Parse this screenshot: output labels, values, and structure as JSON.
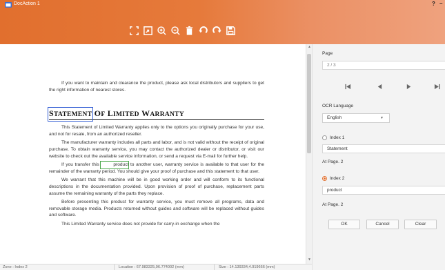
{
  "window": {
    "title": "DocAction 1",
    "help": "?",
    "minimize": "–"
  },
  "toolbar": {
    "buttons": [
      {
        "name": "fit-page-icon"
      },
      {
        "name": "fit-width-icon"
      },
      {
        "name": "zoom-in-icon"
      },
      {
        "name": "zoom-out-icon"
      },
      {
        "name": "delete-icon"
      },
      {
        "name": "rotate-left-icon"
      },
      {
        "name": "rotate-right-icon"
      },
      {
        "name": "save-icon"
      }
    ]
  },
  "document": {
    "intro": "If you want to maintain and clearance the product, please ask local distributors and suppliers to get the right information of nearest stores.",
    "heading_word1_cap": "S",
    "heading_word1_rest": "TATEMENT",
    "heading_rest": " OF LIMITED WARRANTY",
    "heading_of_cap": "O",
    "heading_of_rest": "F",
    "heading_l_cap": "L",
    "heading_l_rest": "IMITED",
    "heading_w_cap": "W",
    "heading_w_rest": "ARRANTY",
    "p1": "This Statement of Limited Warranty applies only to the options you originally purchase for your use, and not for resale, from an authorized reseller.",
    "p2": "The manufacturer warranty includes all parts and labor, and is not valid without the receipt of original purchase. To obtain warranty service, you may contact the authorized dealer or distributor, or visit our website to check out the available service information, or send a request via E-mail for further help.",
    "p3_before": "If you transfer this ",
    "p3_highlight": "product",
    "p3_after": " to another user, warranty service is available to that user for the remainder of the warranty period. You should give your proof of purchase and this statement to that user.",
    "p4": "We warrant that this machine will be in good working order and will conform to its functional descriptions in the documentation provided. Upon provision of proof of purchase, replacement parts assume the remaining warranty of the parts they replace.",
    "p5": "Before presenting this product for warranty service, you must remove all programs, data and removable storage media. Products returned without guides and software will be replaced without guides and software.",
    "p6": "This Limited Warranty service does not provide for carry-in exchange when the"
  },
  "status": {
    "zone": "Zone : Index 2",
    "location": "Location : 67.983325,96.774002 (mm)",
    "size": "Size : 14.139334,4.919666 (mm)"
  },
  "panel": {
    "page_label": "Page",
    "page_value": "2 / 3",
    "ocr_label": "OCR Language",
    "ocr_value": "English",
    "index1_label": "Index 1",
    "index1_value": "Statement",
    "index1_page": "At Page. 2",
    "index2_label": "Index 2",
    "index2_value": "product",
    "index2_page": "At Page. 2",
    "ok_label": "OK",
    "cancel_label": "Cancel",
    "clear_label": "Clear",
    "accent": "#e16f2e"
  }
}
